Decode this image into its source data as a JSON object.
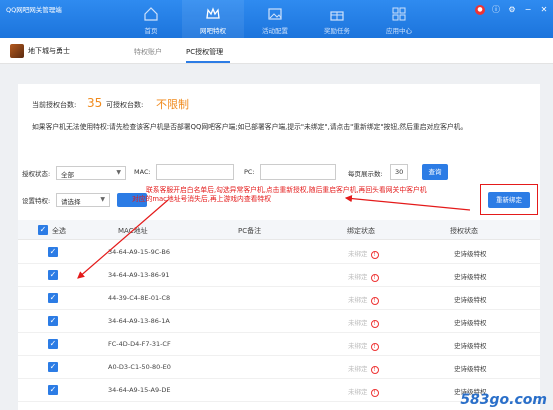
{
  "window": {
    "title": "QQ网吧网关管理端"
  },
  "nav": [
    {
      "label": "首页",
      "icon": "home-icon"
    },
    {
      "label": "网吧特权",
      "icon": "crown-icon"
    },
    {
      "label": "活动配置",
      "icon": "image-icon"
    },
    {
      "label": "奖励任务",
      "icon": "gift-icon"
    },
    {
      "label": "应用中心",
      "icon": "apps-icon"
    }
  ],
  "subbar": {
    "game_name": "地下城与勇士",
    "tabs": [
      "特权账户",
      "PC授权管理"
    ],
    "active_tab": 1
  },
  "info": {
    "current_label": "当前授权台数:",
    "current_value": "35",
    "available_label": "可授权台数:",
    "available_value": "不限制",
    "tip": "如果客户机无法使用特权:请先检查该客户机是否部署QQ网吧客户端;如已部署客户端,提示\"未绑定\",请点击\"重新绑定\"按钮,然后重启对应客户机。"
  },
  "filters": {
    "status_label": "授权状态:",
    "status_value": "全部",
    "mac_label": "MAC:",
    "pc_label": "PC:",
    "page_size_label": "每页展示数:",
    "page_size_value": "30",
    "query_label": "查询",
    "setting_label": "设置特权:",
    "setting_value": "请选择",
    "rebind_label": "重新绑定"
  },
  "annotation": {
    "line1": "联系客服开启白名单后,勾选异常客户机,点击重新授权,随后重启客户机,再回头看网关中客户机",
    "line2": "对应的mac地址号消失后,再上游戏内查看特权"
  },
  "table": {
    "headers": {
      "select_all": "全选",
      "mac": "MAC地址",
      "pc": "PC备注",
      "bind": "绑定状态",
      "priv": "授权状态"
    },
    "rows": [
      {
        "mac": "34-64-A9-15-9C-B6",
        "bind": "未绑定",
        "priv": "史诗级特权"
      },
      {
        "mac": "34-64-A9-13-86-91",
        "bind": "未绑定",
        "priv": "史诗级特权"
      },
      {
        "mac": "44-39-C4-8E-01-C8",
        "bind": "未绑定",
        "priv": "史诗级特权"
      },
      {
        "mac": "34-64-A9-13-86-1A",
        "bind": "未绑定",
        "priv": "史诗级特权"
      },
      {
        "mac": "FC-4D-D4-F7-31-CF",
        "bind": "未绑定",
        "priv": "史诗级特权"
      },
      {
        "mac": "A0-D3-C1-50-80-E0",
        "bind": "未绑定",
        "priv": "史诗级特权"
      },
      {
        "mac": "34-64-A9-15-A9-DE",
        "bind": "未绑定",
        "priv": "史诗级特权"
      }
    ]
  },
  "watermark": "583go.com"
}
